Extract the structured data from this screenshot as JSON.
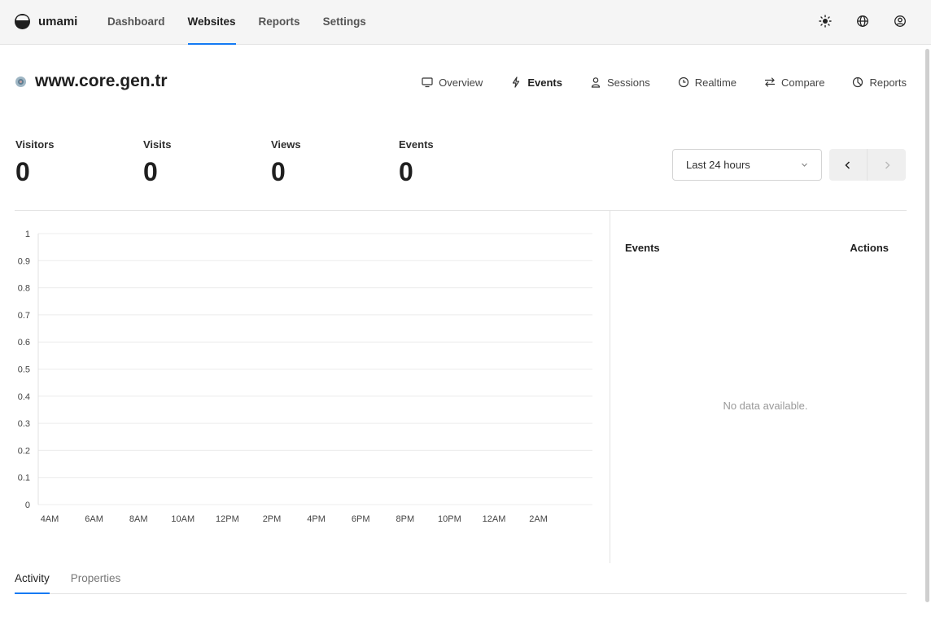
{
  "app": {
    "name": "umami"
  },
  "nav": [
    {
      "label": "Dashboard",
      "active": false
    },
    {
      "label": "Websites",
      "active": true
    },
    {
      "label": "Reports",
      "active": false
    },
    {
      "label": "Settings",
      "active": false
    }
  ],
  "header_icons": [
    "theme-sun-icon",
    "language-globe-icon",
    "profile-icon"
  ],
  "website": {
    "name": "www.core.gen.tr"
  },
  "subnav": [
    {
      "label": "Overview",
      "icon": "monitor-icon",
      "active": false
    },
    {
      "label": "Events",
      "icon": "lightning-icon",
      "active": true
    },
    {
      "label": "Sessions",
      "icon": "user-icon",
      "active": false
    },
    {
      "label": "Realtime",
      "icon": "clock-icon",
      "active": false
    },
    {
      "label": "Compare",
      "icon": "compare-arrows-icon",
      "active": false
    },
    {
      "label": "Reports",
      "icon": "pie-chart-icon",
      "active": false
    }
  ],
  "metrics": [
    {
      "label": "Visitors",
      "value": "0"
    },
    {
      "label": "Visits",
      "value": "0"
    },
    {
      "label": "Views",
      "value": "0"
    },
    {
      "label": "Events",
      "value": "0"
    }
  ],
  "date_range": {
    "selected": "Last 24 hours"
  },
  "chart_data": {
    "type": "bar",
    "categories": [
      "4AM",
      "6AM",
      "8AM",
      "10AM",
      "12PM",
      "2PM",
      "4PM",
      "6PM",
      "8PM",
      "10PM",
      "12AM",
      "2AM"
    ],
    "yticks": [
      "0",
      "0.1",
      "0.2",
      "0.3",
      "0.4",
      "0.5",
      "0.6",
      "0.7",
      "0.8",
      "0.9",
      "1"
    ],
    "ylim": [
      0,
      1
    ],
    "series": [
      {
        "values": [
          0,
          0,
          0,
          0,
          0,
          0,
          0,
          0,
          0,
          0,
          0,
          0
        ]
      }
    ],
    "grid": true,
    "title": "",
    "xlabel": "",
    "ylabel": ""
  },
  "events_panel": {
    "col_events": "Events",
    "col_actions": "Actions",
    "empty_text": "No data available."
  },
  "tabs": [
    {
      "label": "Activity",
      "active": true
    },
    {
      "label": "Properties",
      "active": false
    }
  ],
  "colors": {
    "accent": "#147af3",
    "header_bg": "#f5f5f5"
  }
}
